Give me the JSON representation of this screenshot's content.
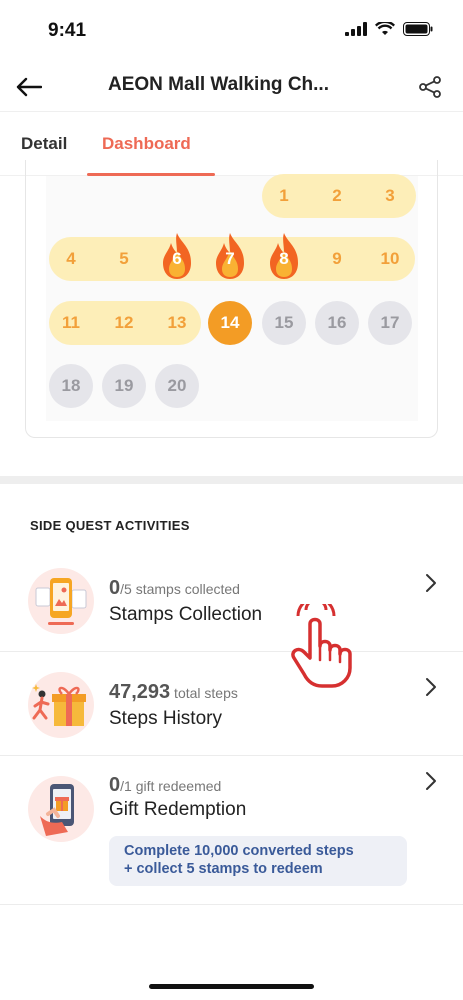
{
  "status_bar": {
    "time": "9:41"
  },
  "header": {
    "title": "AEON Mall Walking Ch..."
  },
  "tabs": [
    {
      "label": "Detail",
      "active": false
    },
    {
      "label": "Dashboard",
      "active": true
    }
  ],
  "calendar": {
    "days": [
      {
        "n": "1",
        "state": "done"
      },
      {
        "n": "2",
        "state": "done"
      },
      {
        "n": "3",
        "state": "done"
      },
      {
        "n": "4",
        "state": "done"
      },
      {
        "n": "5",
        "state": "done"
      },
      {
        "n": "6",
        "state": "fire"
      },
      {
        "n": "7",
        "state": "fire"
      },
      {
        "n": "8",
        "state": "fire"
      },
      {
        "n": "9",
        "state": "done"
      },
      {
        "n": "10",
        "state": "done"
      },
      {
        "n": "11",
        "state": "done"
      },
      {
        "n": "12",
        "state": "done"
      },
      {
        "n": "13",
        "state": "done"
      },
      {
        "n": "14",
        "state": "today"
      },
      {
        "n": "15",
        "state": "future"
      },
      {
        "n": "16",
        "state": "future"
      },
      {
        "n": "17",
        "state": "future"
      },
      {
        "n": "18",
        "state": "future"
      },
      {
        "n": "19",
        "state": "future"
      },
      {
        "n": "20",
        "state": "future"
      }
    ]
  },
  "side_quest": {
    "title": "SIDE QUEST ACTIVITIES",
    "items": [
      {
        "count": "0",
        "count_sub": "/5 stamps collected",
        "label": "Stamps Collection",
        "icon": "phone-stamp-icon"
      },
      {
        "count": "47,293",
        "count_sub": " total steps",
        "label": "Steps History",
        "icon": "gift-runner-icon"
      },
      {
        "count": "0",
        "count_sub": "/1 gift redeemed",
        "label": "Gift Redemption",
        "icon": "phone-gift-icon"
      }
    ],
    "redeem_note_line1": "Complete 10,000 converted steps",
    "redeem_note_line2": "+ collect 5 stamps to redeem"
  },
  "colors": {
    "accent": "#ee6a55",
    "streak": "#f2a03a",
    "today": "#f39c25",
    "note_text": "#3a5a99"
  }
}
